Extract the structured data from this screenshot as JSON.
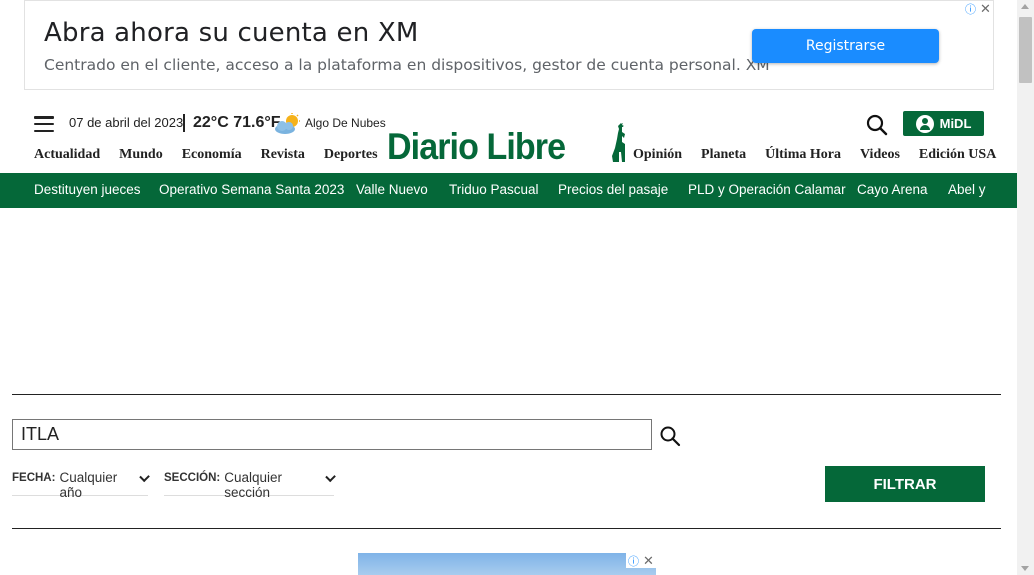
{
  "ad_top": {
    "title": "Abra ahora su cuenta en XM",
    "subtitle": "Centrado en el cliente, acceso a la plataforma en dispositivos, gestor de cuenta personal. XM",
    "button_label": "Registrarse",
    "info_glyph": "ⓘ",
    "close_glyph": "✕"
  },
  "header": {
    "date": "07 de abril del 2023",
    "temperature": "22°C 71.6°F",
    "weather_desc": "Algo De Nubes",
    "weather_icon": "partly-cloudy-icon",
    "logo_text": "Diario Libre",
    "midl_label": "MiDL",
    "nav_left": [
      "Actualidad",
      "Mundo",
      "Economía",
      "Revista",
      "Deportes"
    ],
    "nav_right": [
      "Opinión",
      "Planeta",
      "Última Hora",
      "Videos",
      "Edición USA"
    ]
  },
  "trending": [
    "Destituyen jueces",
    "Operativo Semana Santa 2023",
    "Valle Nuevo",
    "Triduo Pascual",
    "Precios del pasaje",
    "PLD y Operación Calamar",
    "Cayo Arena",
    "Abel y"
  ],
  "search": {
    "value": "ITLA",
    "filters": [
      {
        "label": "FECHA:",
        "value": "Cualquier año"
      },
      {
        "label": "SECCIÓN:",
        "value": "Cualquier sección"
      }
    ],
    "filter_button": "FILTRAR"
  },
  "colors": {
    "brand_green": "#056839",
    "ad_button_blue": "#1a8cff"
  }
}
